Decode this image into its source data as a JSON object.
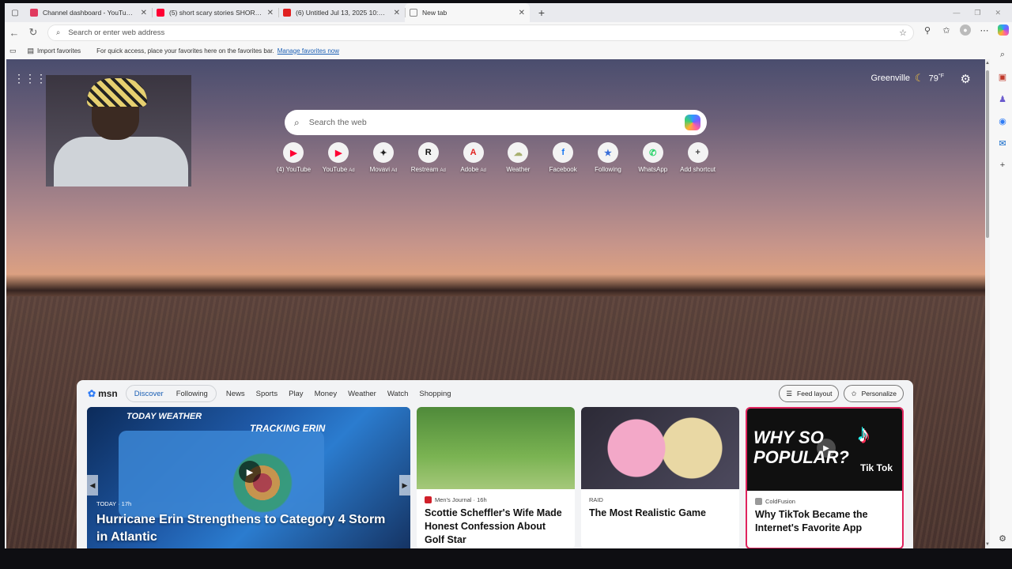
{
  "tabs": [
    {
      "title": "Channel dashboard - YouTube St",
      "favicon_color": "#e03a5f"
    },
    {
      "title": "(5) short scary stories SHORT FIL",
      "favicon_color": "#ff0033"
    },
    {
      "title": "(6) Untitled Jul 13, 2025 10:31 PM",
      "favicon_color": "#e02020"
    },
    {
      "title": "New tab",
      "favicon_color": "#888888"
    }
  ],
  "address": {
    "placeholder": "Search or enter web address"
  },
  "favorites_bar": {
    "import_label": "Import favorites",
    "message": "For quick access, place your favorites here on the favorites bar.",
    "manage_link": "Manage favorites now"
  },
  "weather": {
    "city": "Greenville",
    "temp": "79",
    "unit": "°F"
  },
  "search": {
    "placeholder": "Search the web"
  },
  "shortcuts": [
    {
      "label": "(4) YouTube",
      "ad": "",
      "glyph": "▶",
      "color": "#ff0033"
    },
    {
      "label": "YouTube",
      "ad": "Ad",
      "glyph": "▶",
      "color": "#ff0033"
    },
    {
      "label": "Movavi",
      "ad": "Ad",
      "glyph": "✦",
      "color": "#222222"
    },
    {
      "label": "Restream",
      "ad": "Ad",
      "glyph": "R",
      "color": "#111111"
    },
    {
      "label": "Adobe",
      "ad": "Ad",
      "glyph": "A",
      "color": "#e2221f"
    },
    {
      "label": "Weather",
      "ad": "",
      "glyph": "☁",
      "color": "#a8b070"
    },
    {
      "label": "Facebook",
      "ad": "",
      "glyph": "f",
      "color": "#1877f2"
    },
    {
      "label": "Following",
      "ad": "",
      "glyph": "★",
      "color": "#3a6fd8"
    },
    {
      "label": "WhatsApp",
      "ad": "",
      "glyph": "✆",
      "color": "#25d366"
    },
    {
      "label": "Add shortcut",
      "ad": "",
      "glyph": "+",
      "color": "#444444"
    }
  ],
  "feed": {
    "brand": "msn",
    "tabs_pill": [
      "Discover",
      "Following"
    ],
    "tabs": [
      "News",
      "Sports",
      "Play",
      "Money",
      "Weather",
      "Watch",
      "Shopping"
    ],
    "feed_layout_label": "Feed layout",
    "personalize_label": "Personalize"
  },
  "hero": {
    "badge": "TODAY WEATHER",
    "map_text": "TRACKING ERIN",
    "meta": "TODAY · 17h",
    "title": "Hurricane Erin Strengthens to Category 4 Storm in Atlantic"
  },
  "cards": [
    {
      "source": "Men's Journal · 16h",
      "title": "Scottie Scheffler's Wife Made Honest Confession About Golf Star",
      "src_color": "#d0202a"
    },
    {
      "source": "RAID",
      "title": "The Most Realistic Game",
      "src_color": ""
    },
    {
      "source": "ColdFusion",
      "title": "Why TikTok Became the Internet's Favorite App",
      "src_color": "#999999",
      "image_text": "WHY SO POPULAR?",
      "image_brand": "Tik Tok"
    }
  ],
  "colors": {
    "accent": "#1a5fb4",
    "tiktok_border": "#e0245e"
  }
}
